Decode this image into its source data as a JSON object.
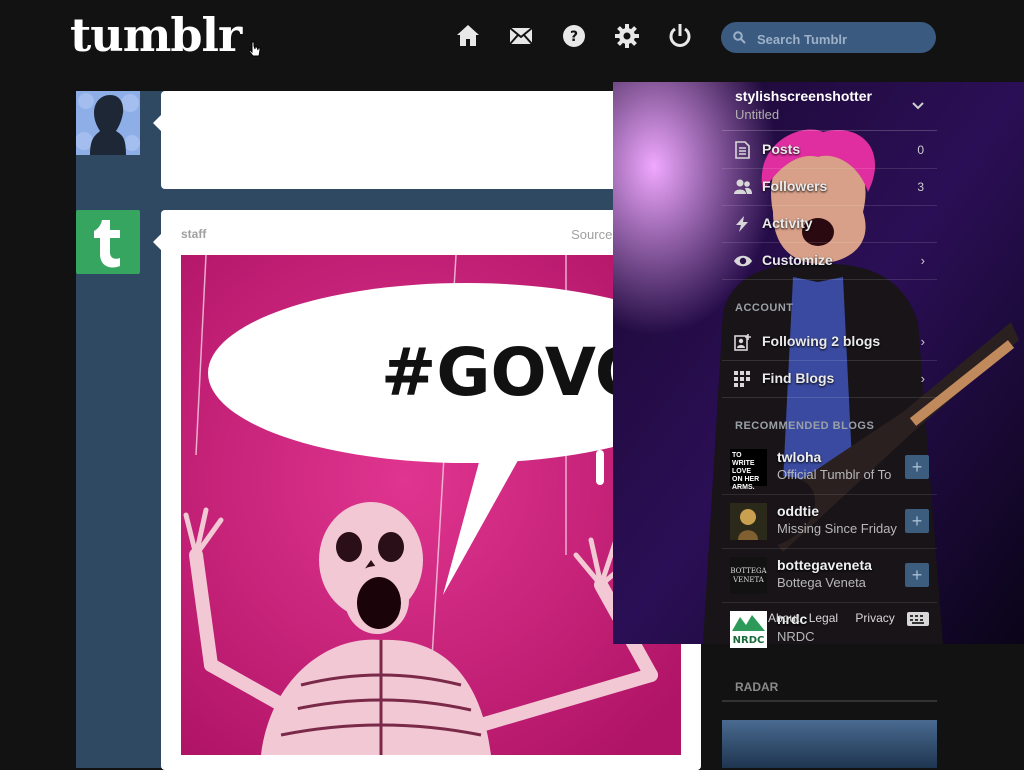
{
  "header": {
    "logo": "tumblr",
    "nav_icons": [
      "home-icon",
      "mail-icon",
      "help-icon",
      "gear-icon",
      "power-icon"
    ],
    "search_placeholder": "Search Tumblr"
  },
  "dashboard": {
    "staff_post": {
      "author": "staff",
      "source": "Source: govote.org",
      "image_text": "#GOVOTE"
    }
  },
  "sidebar": {
    "blog": {
      "name": "stylishscreenshotter",
      "title": "Untitled"
    },
    "menu": [
      {
        "label": "Posts",
        "count": "0",
        "icon": "posts-icon"
      },
      {
        "label": "Followers",
        "count": "3",
        "icon": "followers-icon"
      },
      {
        "label": "Activity",
        "count": "",
        "icon": "activity-icon"
      },
      {
        "label": "Customize",
        "count": "",
        "icon": "eye-icon"
      }
    ],
    "account_heading": "ACCOUNT",
    "account": [
      {
        "label": "Following 2 blogs",
        "icon": "following-icon"
      },
      {
        "label": "Find Blogs",
        "icon": "find-blogs-icon"
      }
    ],
    "recommended_heading": "RECOMMENDED BLOGS",
    "recommended": [
      {
        "name": "twloha",
        "subtitle": "Official Tumblr of To"
      },
      {
        "name": "oddtie",
        "subtitle": "Missing Since Friday"
      },
      {
        "name": "bottegaveneta",
        "subtitle": "Bottega Veneta"
      },
      {
        "name": "nrdc",
        "subtitle": "NRDC"
      }
    ],
    "footer": {
      "about": "About",
      "legal": "Legal",
      "privacy": "Privacy"
    },
    "radar_heading": "RADAR"
  },
  "colors": {
    "background": "#121212",
    "dash_blue": "#2f4963",
    "tumblr_green": "#36a560"
  }
}
